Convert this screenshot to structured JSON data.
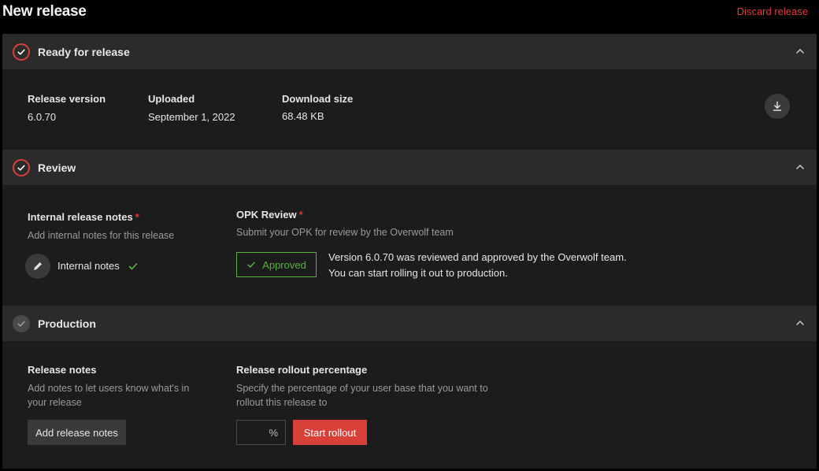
{
  "header": {
    "title": "New release",
    "discard_label": "Discard release"
  },
  "sections": {
    "ready": {
      "title": "Ready for release",
      "status": "done",
      "fields": {
        "version_label": "Release version",
        "version_value": "6.0.70",
        "uploaded_label": "Uploaded",
        "uploaded_value": "September 1, 2022",
        "size_label": "Download size",
        "size_value": "68.48 KB"
      },
      "download_icon": "download-icon"
    },
    "review": {
      "title": "Review",
      "status": "done",
      "internal_notes": {
        "label": "Internal release notes",
        "required_mark": "*",
        "description": "Add internal notes for this release",
        "item_label": "Internal notes",
        "item_icon": "pencil-icon",
        "check_icon": "check-icon"
      },
      "opk": {
        "label": "OPK Review",
        "required_mark": "*",
        "description": "Submit your OPK for review by the Overwolf team",
        "badge_label": "Approved",
        "message_line1": "Version 6.0.70 was reviewed and approved by the Overwolf team.",
        "message_line2": "You can start rolling it out to production."
      }
    },
    "production": {
      "title": "Production",
      "status": "pending",
      "release_notes": {
        "label": "Release notes",
        "description_line1": "Add notes to let users know what's in",
        "description_line2": "your release",
        "button_label": "Add release notes"
      },
      "rollout": {
        "label": "Release rollout percentage",
        "description_line1": "Specify the percentage of your user base that you want to",
        "description_line2": "rollout this release to",
        "input_value": "",
        "percent_symbol": "%",
        "button_label": "Start rollout"
      }
    }
  },
  "colors": {
    "accent_red": "#d9403a",
    "approved_green": "#58b141",
    "header_bg": "#2b2b2b",
    "body_bg": "#1c1c1c"
  }
}
